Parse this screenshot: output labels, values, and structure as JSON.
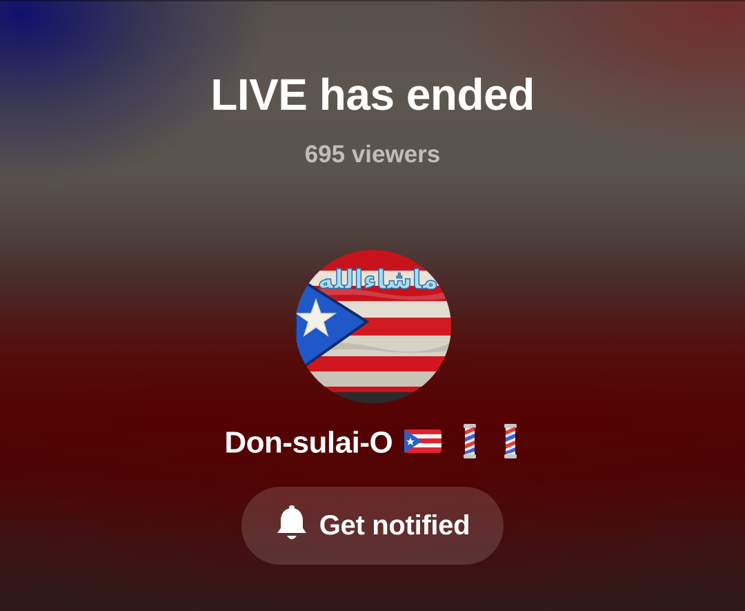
{
  "live_end": {
    "title": "LIVE has ended",
    "viewers_text": "695 viewers"
  },
  "host": {
    "username": "Don-sulai-O",
    "avatar_caption": "ماشاءالله",
    "name_emoji": [
      "puerto-rico-flag-icon",
      "barber-pole-icon",
      "barber-pole-icon"
    ]
  },
  "actions": {
    "notify_label": "Get notified",
    "notify_icon": "bell-icon"
  },
  "colors": {
    "background_top": "#57504a",
    "background_bottom": "#520303",
    "button_fill": "rgba(255,255,255,0.14)",
    "text_primary": "#ffffff",
    "text_secondary": "rgba(255,255,255,0.62)"
  }
}
